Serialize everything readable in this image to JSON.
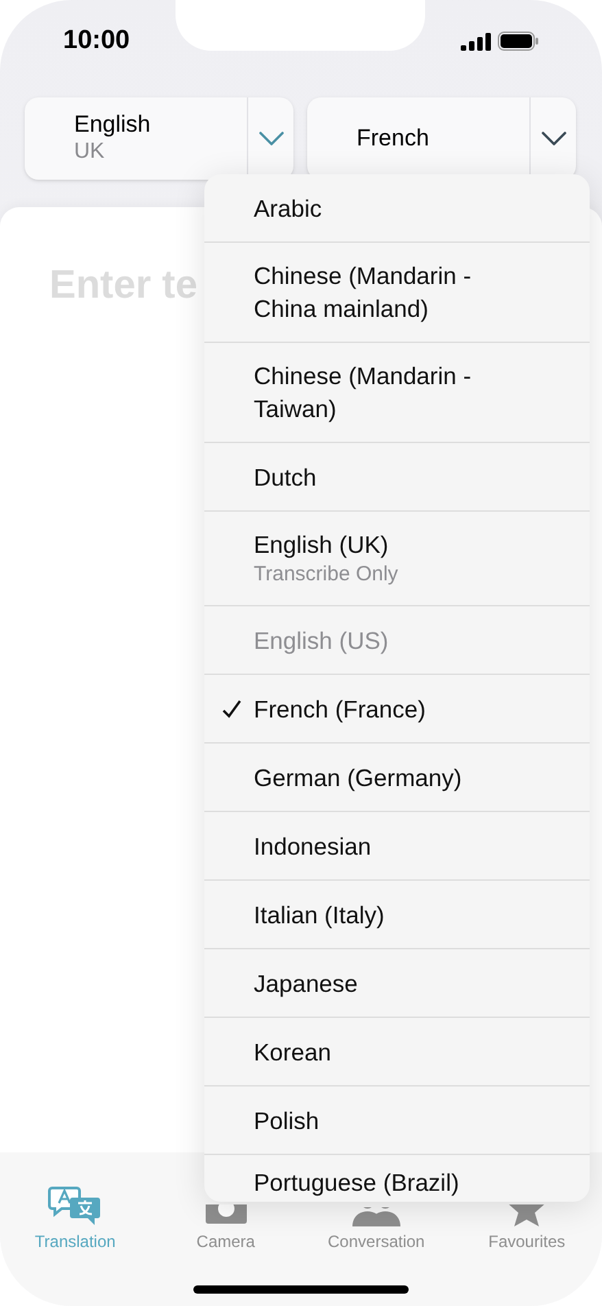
{
  "status_bar": {
    "time": "10:00"
  },
  "language_selectors": [
    {
      "language": "English",
      "region": "UK",
      "selected": true
    },
    {
      "language": "French",
      "selected": false
    }
  ],
  "input": {
    "placeholder": "Enter te"
  },
  "language_menu": [
    {
      "label": "Arabic",
      "selected": false,
      "disabled": false
    },
    {
      "label": "Chinese (Mandarin - China mainland)",
      "selected": false,
      "disabled": false
    },
    {
      "label": "Chinese (Mandarin - Taiwan)",
      "selected": false,
      "disabled": false
    },
    {
      "label": "Dutch",
      "selected": false,
      "disabled": false
    },
    {
      "label": "English (UK)",
      "subtitle": "Transcribe Only",
      "selected": false,
      "disabled": false
    },
    {
      "label": "English (US)",
      "selected": false,
      "disabled": true
    },
    {
      "label": "French (France)",
      "selected": true,
      "disabled": false
    },
    {
      "label": "German (Germany)",
      "selected": false,
      "disabled": false
    },
    {
      "label": "Indonesian",
      "selected": false,
      "disabled": false
    },
    {
      "label": "Italian (Italy)",
      "selected": false,
      "disabled": false
    },
    {
      "label": "Japanese",
      "selected": false,
      "disabled": false
    },
    {
      "label": "Korean",
      "selected": false,
      "disabled": false
    },
    {
      "label": "Polish",
      "selected": false,
      "disabled": false
    },
    {
      "label": "Portuguese (Brazil)",
      "selected": false,
      "disabled": false
    }
  ],
  "tab_bar": [
    {
      "kind": "translation",
      "label": "Translation",
      "selected": true
    },
    {
      "kind": "camera",
      "label": "Camera",
      "selected": false
    },
    {
      "kind": "conversation",
      "label": "Conversation",
      "selected": false
    },
    {
      "kind": "favourites",
      "label": "Favourites",
      "selected": false
    }
  ]
}
